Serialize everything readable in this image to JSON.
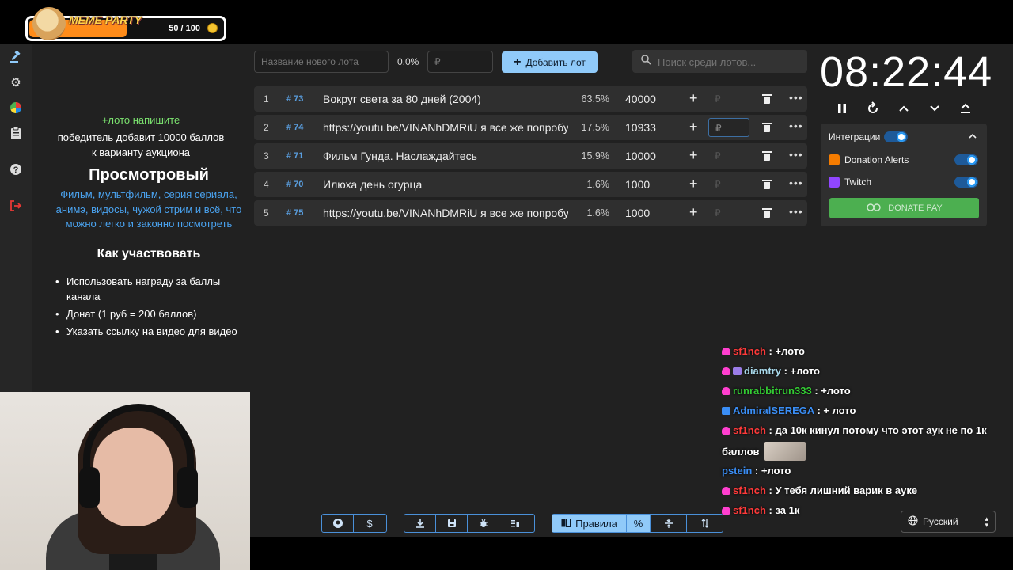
{
  "overlay": {
    "meme_title": "MEME PARTY",
    "meme_count": "50 / 100",
    "meme_progress": 0.5
  },
  "sidebar": {
    "icons": [
      "gavel-icon",
      "gear-icon",
      "pie-chart-icon",
      "clipboard-icon",
      "help-icon",
      "logout-icon"
    ]
  },
  "rules": {
    "green": "+лото напишите",
    "white": "победитель добавит 10000 баллов к варианту аукциона",
    "heading": "Просмотровый",
    "blue": "Фильм, мультфильм, серия сериала, анимэ, видосы, чужой стрим и всё, что можно легко и законно посмотреть",
    "howto": "Как участвовать",
    "items": [
      "Использовать награду за баллы канала",
      "Донат (1 руб = 200 баллов)",
      "Указать ссылку на видео для видео"
    ]
  },
  "toprow": {
    "lot_placeholder": "Название нового лота",
    "percent": "0.0%",
    "rub_placeholder": "₽",
    "add_label": "Добавить лот",
    "search_placeholder": "Поиск среди лотов..."
  },
  "lots": [
    {
      "idx": "1",
      "id": "# 73",
      "title": "Вокруг света за 80 дней (2004)",
      "pct": "63.5%",
      "amount": "40000",
      "rub": "₽"
    },
    {
      "idx": "2",
      "id": "# 74",
      "title": "https://youtu.be/VINANhDMRiU я все же попробую",
      "pct": "17.5%",
      "amount": "10933",
      "rub": "₽"
    },
    {
      "idx": "3",
      "id": "# 71",
      "title": "Фильм Гунда. Наслаждайтесь",
      "pct": "15.9%",
      "amount": "10000",
      "rub": "₽"
    },
    {
      "idx": "4",
      "id": "# 70",
      "title": "Илюха день огурца",
      "pct": "1.6%",
      "amount": "1000",
      "rub": "₽"
    },
    {
      "idx": "5",
      "id": "# 75",
      "title": "https://youtu.be/VINANhDMRiU я все же попробую",
      "pct": "1.6%",
      "amount": "1000",
      "rub": "₽"
    }
  ],
  "timer": {
    "value": "08:22:44"
  },
  "integrations": {
    "title": "Интеграции",
    "items": [
      {
        "name": "Donation Alerts",
        "color": "#f57c00"
      },
      {
        "name": "Twitch",
        "color": "#9146ff"
      }
    ],
    "donate_label": "DONATE PAY"
  },
  "chat": [
    {
      "user": "sf1nch",
      "color": "#ff3a3a",
      "badge": "heart",
      "msg": ": +лото"
    },
    {
      "user": "diamtry",
      "color": "#a8d8ea",
      "badge": "heart",
      "msg": ": +лото"
    },
    {
      "user": "runrabbitrun333",
      "color": "#33cc33",
      "badge": "heart",
      "msg": ": +лото"
    },
    {
      "user": "AdmiralSEREGA",
      "color": "#3a8ef6",
      "badge": "vrf",
      "msg": ": + лото"
    },
    {
      "user": "sf1nch",
      "color": "#ff3a3a",
      "badge": "heart",
      "msg": ": да 10к кинул потому что этот аук не по 1к"
    },
    {
      "user": "",
      "color": "#ffffff",
      "badge": "",
      "msg": "баллов"
    },
    {
      "user": "pstein",
      "color": "#3a8ef6",
      "badge": "",
      "msg": ": +лото"
    },
    {
      "user": "sf1nch",
      "color": "#ff3a3a",
      "badge": "heart",
      "msg": ": У тебя лишний варик в ауке"
    },
    {
      "user": "sf1nch",
      "color": "#ff3a3a",
      "badge": "heart",
      "msg": ": за 1к"
    }
  ],
  "toolbar": {
    "rules_label": "Правила"
  },
  "language": {
    "value": "Русский"
  }
}
